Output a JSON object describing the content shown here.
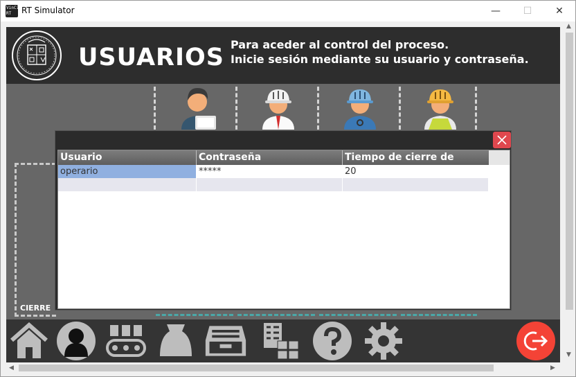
{
  "window": {
    "icon_text": "VinCi RT",
    "title": "RT Simulator",
    "minimize_glyph": "—",
    "maximize_glyph": "☐",
    "close_glyph": "✕"
  },
  "header": {
    "title": "USUARIOS",
    "message_line1": "Para aceder al control del proceso.",
    "message_line2": "Inicie sesión mediante su usuario y contraseña.",
    "seal_icon": "university-seal-icon"
  },
  "side_label": "CIERRE",
  "avatars": [
    {
      "name": "office-worker-avatar-icon"
    },
    {
      "name": "engineer-white-helmet-avatar-icon"
    },
    {
      "name": "technician-blue-helmet-avatar-icon"
    },
    {
      "name": "operator-yellow-helmet-avatar-icon"
    }
  ],
  "dialog": {
    "close_glyph": "✕",
    "columns": [
      "Usuario",
      "Contraseña",
      "Tiempo de cierre de sesión"
    ],
    "rows": [
      [
        "operario",
        "*****",
        "20"
      ],
      [
        "",
        "",
        ""
      ]
    ]
  },
  "footer": {
    "icons": [
      "home-icon",
      "user-icon",
      "conveyor-icon",
      "sack-icon",
      "drawer-icon",
      "inventory-checklist-icon",
      "help-icon",
      "settings-icon"
    ],
    "logout_icon": "logout-icon"
  },
  "colors": {
    "header_bg": "#2d2d2d",
    "app_bg": "#676767",
    "close_red": "#e0474e",
    "logout_red": "#f44336",
    "selection_blue": "#90b0e0"
  }
}
